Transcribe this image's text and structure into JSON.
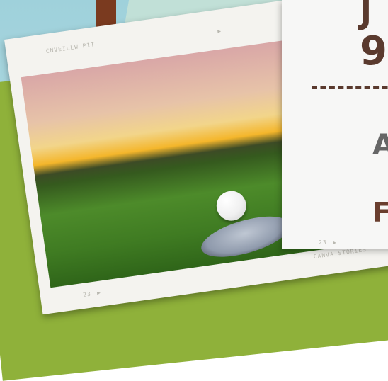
{
  "photo": {
    "corner_label_top": "CNVEILLW PIT",
    "frame_number_bottom": "23",
    "brand_label": "CANVA STORIES"
  },
  "card": {
    "line1": "J",
    "line2": "9",
    "line3": "A",
    "line4": "F",
    "frame_number": "23"
  }
}
